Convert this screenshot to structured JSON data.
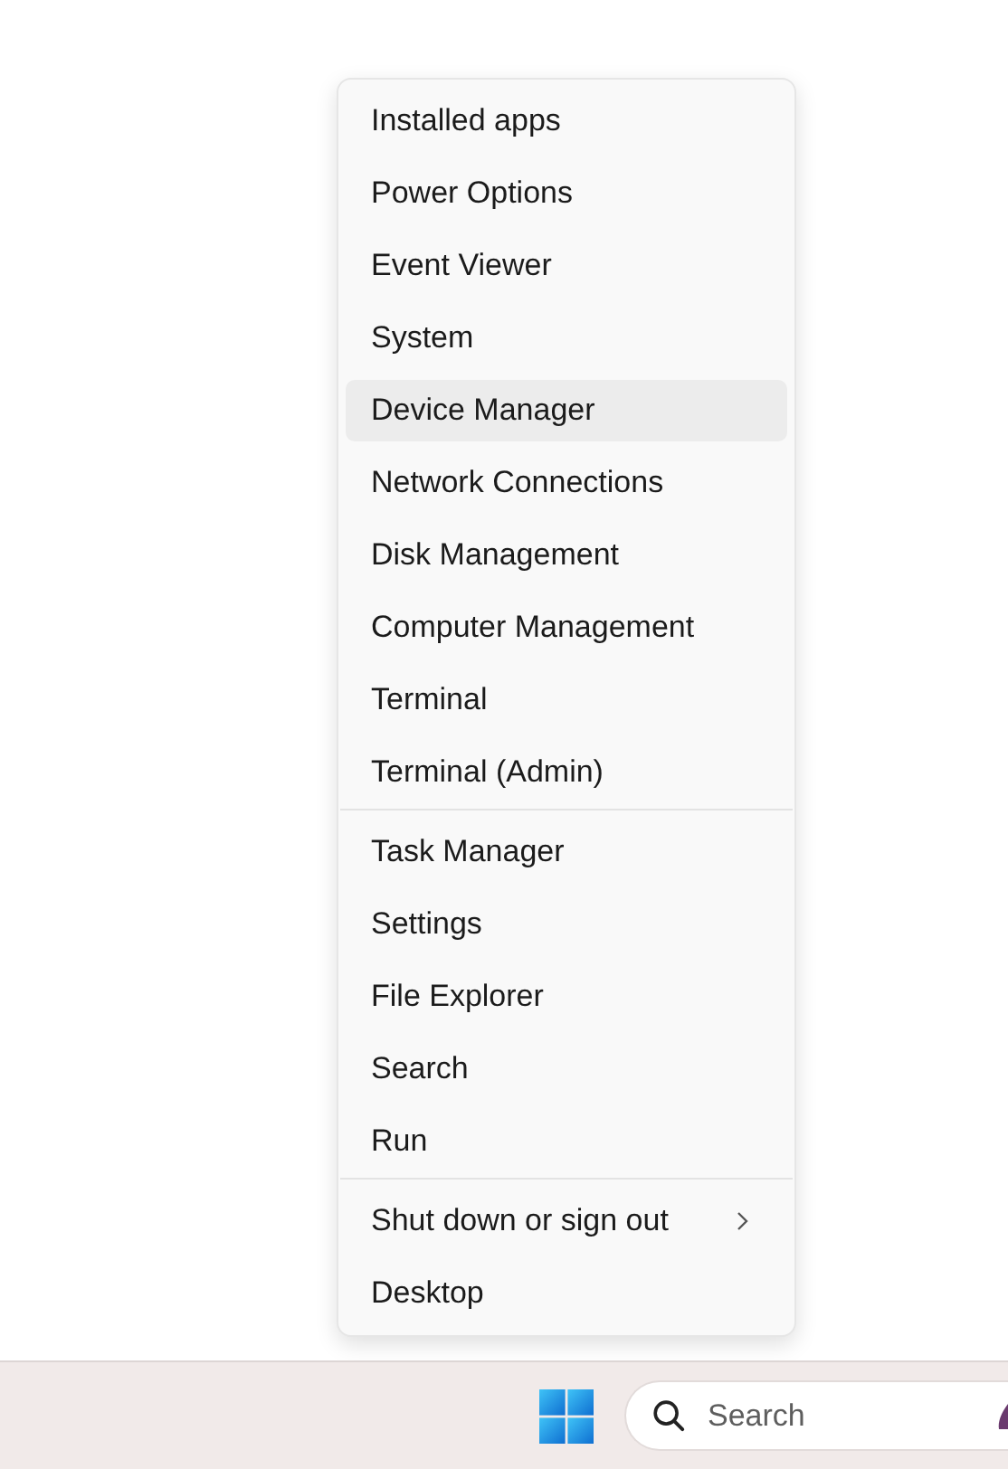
{
  "menu": {
    "groups": [
      {
        "items": [
          {
            "label": "Installed apps",
            "hovered": false,
            "has_submenu": false
          },
          {
            "label": "Power Options",
            "hovered": false,
            "has_submenu": false
          },
          {
            "label": "Event Viewer",
            "hovered": false,
            "has_submenu": false
          },
          {
            "label": "System",
            "hovered": false,
            "has_submenu": false
          },
          {
            "label": "Device Manager",
            "hovered": true,
            "has_submenu": false
          },
          {
            "label": "Network Connections",
            "hovered": false,
            "has_submenu": false
          },
          {
            "label": "Disk Management",
            "hovered": false,
            "has_submenu": false
          },
          {
            "label": "Computer Management",
            "hovered": false,
            "has_submenu": false
          },
          {
            "label": "Terminal",
            "hovered": false,
            "has_submenu": false
          },
          {
            "label": "Terminal (Admin)",
            "hovered": false,
            "has_submenu": false
          }
        ]
      },
      {
        "items": [
          {
            "label": "Task Manager",
            "hovered": false,
            "has_submenu": false
          },
          {
            "label": "Settings",
            "hovered": false,
            "has_submenu": false
          },
          {
            "label": "File Explorer",
            "hovered": false,
            "has_submenu": false
          },
          {
            "label": "Search",
            "hovered": false,
            "has_submenu": false
          },
          {
            "label": "Run",
            "hovered": false,
            "has_submenu": false
          }
        ]
      },
      {
        "items": [
          {
            "label": "Shut down or sign out",
            "hovered": false,
            "has_submenu": true
          },
          {
            "label": "Desktop",
            "hovered": false,
            "has_submenu": false
          }
        ]
      }
    ]
  },
  "taskbar": {
    "search": {
      "placeholder": "Search"
    }
  }
}
